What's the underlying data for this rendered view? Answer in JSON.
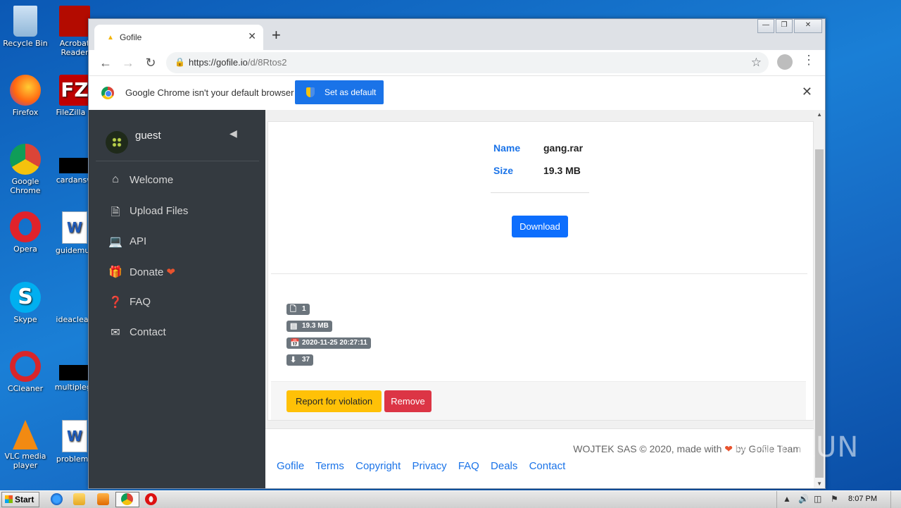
{
  "desktop": {
    "icons": [
      {
        "label": "Recycle Bin",
        "icon": "recycle-bin-icon"
      },
      {
        "label": "Acrobat Reader",
        "icon": "acrobat-reader-icon"
      },
      {
        "label": "Firefox",
        "icon": "firefox-icon"
      },
      {
        "label": "FileZilla C",
        "icon": "filezilla-icon"
      },
      {
        "label": "Google Chrome",
        "icon": "chrome-icon"
      },
      {
        "label": "cardansw",
        "icon": "file-icon"
      },
      {
        "label": "Opera",
        "icon": "opera-icon"
      },
      {
        "label": "guidemus",
        "icon": "word-doc-icon"
      },
      {
        "label": "Skype",
        "icon": "skype-icon"
      },
      {
        "label": "ideaclean",
        "icon": "file-icon"
      },
      {
        "label": "CCleaner",
        "icon": "ccleaner-icon"
      },
      {
        "label": "multiplegr",
        "icon": "file-icon"
      },
      {
        "label": "VLC media player",
        "icon": "vlc-icon"
      },
      {
        "label": "problemo",
        "icon": "word-doc-icon"
      }
    ]
  },
  "browser": {
    "tab_title": "Gofile",
    "url_host": "https://gofile.io",
    "url_path": "/d/8Rtos2",
    "infobar_message": "Google Chrome isn't your default browser",
    "infobar_button": "Set as default"
  },
  "sidebar": {
    "username": "guest",
    "items": [
      {
        "label": "Welcome",
        "icon": "home-icon"
      },
      {
        "label": "Upload Files",
        "icon": "upload-file-icon"
      },
      {
        "label": "API",
        "icon": "api-icon"
      },
      {
        "label": "Donate",
        "icon": "gift-icon"
      },
      {
        "label": "FAQ",
        "icon": "question-icon"
      },
      {
        "label": "Contact",
        "icon": "envelope-icon"
      }
    ]
  },
  "file": {
    "name_label": "Name",
    "name_value": "gang.rar",
    "size_label": "Size",
    "size_value": "19.3 MB",
    "download_label": "Download",
    "badges": {
      "files": "1",
      "size": "19.3 MB",
      "date": "2020-11-25 20:27:11",
      "downloads": "37"
    },
    "report_label": "Report for violation",
    "remove_label": "Remove"
  },
  "footer": {
    "credit_prefix": "WOJTEK SAS © 2020, made with",
    "credit_suffix": "by Gofile Team",
    "links": [
      "Gofile",
      "Terms",
      "Copyright",
      "Privacy",
      "FAQ",
      "Deals",
      "Contact"
    ]
  },
  "watermark": "ANY.RUN",
  "taskbar": {
    "start_label": "Start",
    "clock": "8:07 PM"
  },
  "colors": {
    "accent": "#1a73e8",
    "sidebar_bg": "#343a40",
    "warning": "#ffc107",
    "danger": "#dc3545",
    "heart": "#e8532e"
  }
}
